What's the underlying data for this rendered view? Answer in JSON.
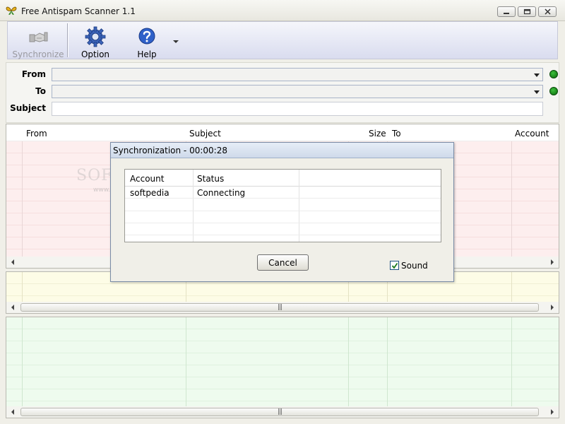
{
  "window": {
    "title": "Free Antispam Scanner 1.1"
  },
  "toolbar": {
    "synchronize_label": "Synchronize",
    "option_label": "Option",
    "help_label": "Help"
  },
  "filters": {
    "from_label": "From",
    "to_label": "To",
    "subject_label": "Subject",
    "from_value": "",
    "to_value": "",
    "subject_value": ""
  },
  "message_list": {
    "columns": [
      "From",
      "Subject",
      "Size",
      "To",
      "Account"
    ]
  },
  "dialog": {
    "title": "Synchronization - 00:00:28",
    "columns": [
      "Account",
      "Status"
    ],
    "rows": [
      {
        "account": "softpedia",
        "status": "Connecting"
      }
    ],
    "cancel_label": "Cancel",
    "sound_label": "Sound",
    "sound_checked": true
  },
  "watermark": {
    "text": "SOFTPEDIA",
    "url": "www.softpedia.com"
  },
  "icons": {
    "app": "butterfly-icon",
    "synchronize": "handshake-icon",
    "option": "gear-icon",
    "help": "help-icon"
  },
  "colors": {
    "status_led": "#1f9a1f",
    "spam_list_bg": "#fdeeee",
    "suspect_list_bg": "#fdfce6",
    "clean_list_bg": "#eefbee"
  }
}
